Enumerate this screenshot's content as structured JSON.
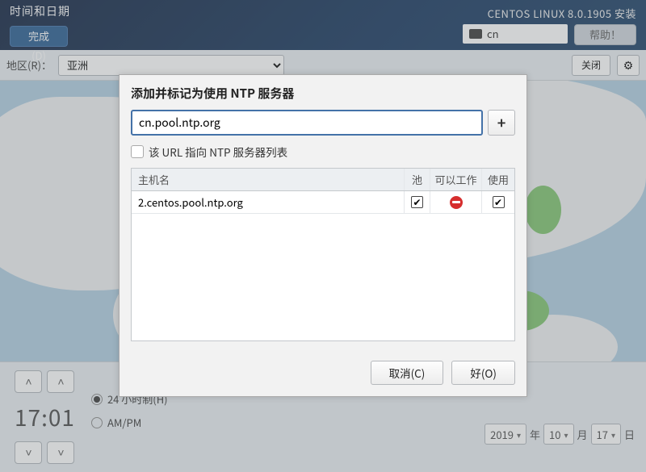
{
  "header": {
    "title": "时间和日期",
    "done_label": "完成(D)",
    "install_label": "CENTOS LINUX 8.0.1905 安装",
    "lang_code": "cn",
    "help_label": "帮助！"
  },
  "region": {
    "label": "地区(R)：",
    "selected": "亚洲",
    "close_label": "关闭"
  },
  "bottom": {
    "time": "17:01",
    "format24_label": "24 小时制(H)",
    "ampm_label": "AM/PM",
    "format24_selected": true,
    "date": {
      "year": "2019",
      "year_suffix": "年",
      "month": "10",
      "month_suffix": "月",
      "day": "17",
      "day_suffix": "日"
    }
  },
  "dialog": {
    "title": "添加并标记为使用 NTP 服务器",
    "input_value": "cn.pool.ntp.org",
    "add_label": "+",
    "url_checkbox_label": "该 URL 指向 NTP 服务器列表",
    "columns": {
      "host": "主机名",
      "pool": "池",
      "working": "可以工作",
      "use": "使用"
    },
    "rows": [
      {
        "host": "2.centos.pool.ntp.org",
        "pool": true,
        "working": false,
        "use": true
      }
    ],
    "cancel_label": "取消(C)",
    "ok_label": "好(O)"
  }
}
